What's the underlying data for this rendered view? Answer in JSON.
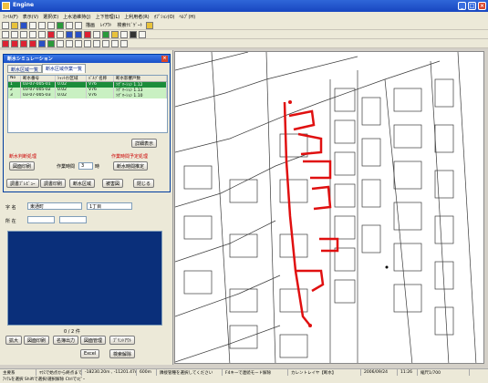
{
  "window": {
    "title": "Engine"
  },
  "menu": [
    "ﾌｧｲﾙ(F)",
    "表示(V)",
    "選択(E)",
    "上水道維持(J)",
    "上下管理(L)",
    "上利用者(R)",
    "ｵﾌﾟｼｮﾝ(O)",
    "ﾍﾙﾌﾟ(H)"
  ],
  "toolbar": {
    "label_a": "描画",
    "label_b": "ﾚｲｱｳﾄ",
    "label_c": "検索ﾅﾋﾞｹﾞｰﾄ"
  },
  "dialog": {
    "title": "断水シミュレーション",
    "tabs": [
      "断水区域一覧",
      "断水区域作業一覧"
    ],
    "columns": [
      "No",
      "断水番号",
      "ｼｬｯﾄｵﾌ区域",
      "ﾊﾞﾙﾌﾞ名称",
      "断水影響戸数"
    ],
    "rows": [
      {
        "no": "1",
        "id": "03-07-005-01",
        "v": "0.02",
        "type": "V76",
        "name": "ｿｸﾞﾏｰｼｮﾝ 1.12"
      },
      {
        "no": "2",
        "id": "03-07-005-02",
        "v": "0.02",
        "type": "V76",
        "name": "ｿｸﾞﾏｰｼｮﾝ 1.13"
      },
      {
        "no": "3",
        "id": "03-07-005-03",
        "v": "0.02",
        "type": "V76",
        "name": "ｿｸﾞﾏｰｼｮﾝ 1.10"
      }
    ],
    "detail_button": "詳細表示",
    "section_left": "断水判断処理",
    "section_right": "作業時間予定処理",
    "print_button": "図面印刷",
    "time_label": "作業時間",
    "time_value": "3",
    "time_unit": "時",
    "calc_button": "断水時間推定",
    "preview_button": "調書ﾌﾟﾚﾋﾞｭｰ",
    "report_button": "調書印刷",
    "area_button": "断水区域",
    "save_button": "被害図",
    "close_button": "閉じる"
  },
  "search": {
    "label_name": "字 名",
    "name_value": "東通町",
    "name_suffix": "1丁目",
    "label_addr": "所 在"
  },
  "list": {
    "count": "0 / 2 件"
  },
  "bottom_buttons": [
    "拡大",
    "図面印刷",
    "名簿出力",
    "図面管理",
    "ﾌﾟﾘﾝﾄｱｳﾄ"
  ],
  "excel_button": "Excel",
  "back_button": "検索解除",
  "status": {
    "layer": "主要系",
    "msg": "ﾏｳｽで始点から終点までﾄﾞﾗｯｸﾞ",
    "coord": "-18230.20m , -11201.47m",
    "scale": "600m",
    "hint": "隣接管種を選択してください",
    "f4": "F4キーで連続モード解除",
    "mode": "カレントレイヤ【断水】",
    "date": "2006/09/24",
    "time": "11:26",
    "zoom": "縮尺1/700"
  },
  "footer": "ｱｲﾃﾑを選択 Shiftで選択/選択解除 Ctrlでｺﾋﾟｰ"
}
